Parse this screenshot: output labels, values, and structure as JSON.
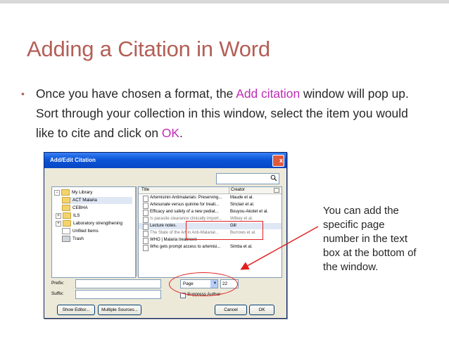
{
  "slide": {
    "title": "Adding a Citation in Word",
    "bullet_dot": "•",
    "bullet_part1": "Once you have chosen a format, the ",
    "bullet_highlight1": "Add citation",
    "bullet_part2": " window will pop up. Sort through your collection in this window, select the item you would like to cite and click on ",
    "bullet_highlight2": "OK",
    "bullet_part3": ".",
    "callout": "You can add the specific page number in the text box at the bottom of the window.",
    "title_color": "#b35f56",
    "highlight_color": "#c02bb6",
    "annotation_color": "#e02020"
  },
  "dialog": {
    "title": "Add/Edit Citation",
    "close": "x",
    "library": {
      "items": [
        {
          "expander": "−",
          "label": "My Library"
        },
        {
          "expander": "",
          "label": "ACT Malaria"
        },
        {
          "expander": "",
          "label": "CEBHA"
        },
        {
          "expander": "+",
          "label": "ILS"
        },
        {
          "expander": "+",
          "label": "Laboratory strengthening"
        },
        {
          "expander": "",
          "label": "Unfiled Items"
        },
        {
          "expander": "",
          "label": "Trash"
        }
      ]
    },
    "columns": {
      "title": "Title",
      "creator": "Creator"
    },
    "rows": [
      {
        "title": "Artemisinin Antimalarials: Preserving...",
        "creator": "Maude et al."
      },
      {
        "title": "Artesunate versus quinine for treati...",
        "creator": "Sinclair et al."
      },
      {
        "title": "Efficacy and safety of a new pediat...",
        "creator": "Bouyou-Akotet et al."
      },
      {
        "title": "Is parasite clearance clinically import...",
        "creator": "Wilkey et al."
      },
      {
        "title": "Lecture notes.",
        "creator": "Gill"
      },
      {
        "title": "The State of the Art in Anti-Malarial...",
        "creator": "Burrows et al."
      },
      {
        "title": "WHO | Malaria treatment",
        "creator": ""
      },
      {
        "title": "Who gets prompt access to artemisi...",
        "creator": "Simba et al."
      }
    ],
    "prefix_label": "Prefix:",
    "suffix_label": "Suffix:",
    "locator_type": "Page",
    "locator_value": "22",
    "suppress_author": "Suppress Author",
    "buttons": {
      "show_editor": "Show Editor...",
      "multiple_sources": "Multiple Sources...",
      "cancel": "Cancel",
      "ok": "OK"
    }
  }
}
